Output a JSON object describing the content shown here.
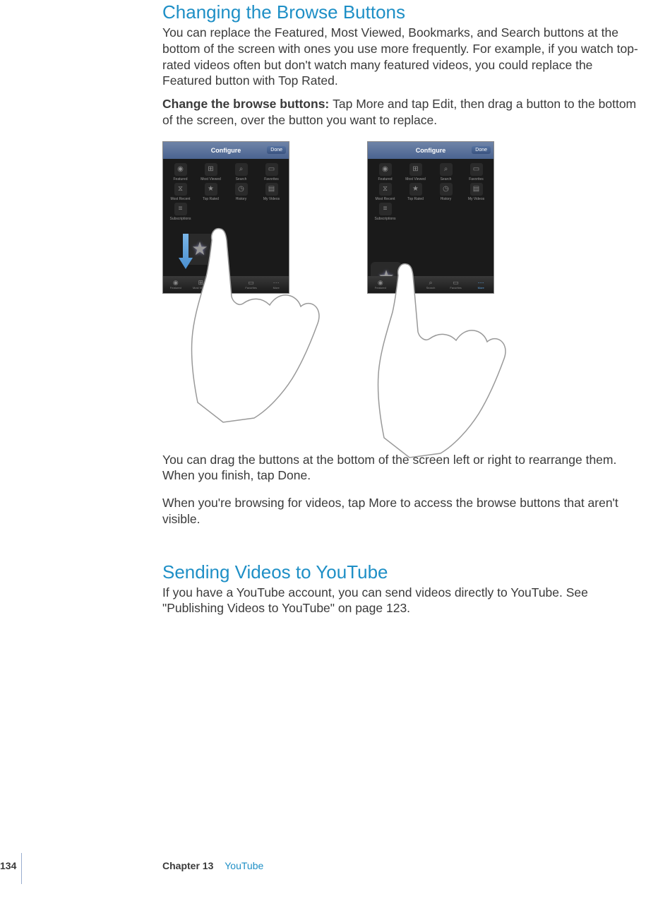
{
  "section1": {
    "heading": "Changing the Browse Buttons",
    "intro": "You can replace the Featured, Most Viewed, Bookmarks, and Search buttons at the bottom of the screen with ones you use more frequently. For example, if you watch top-rated videos often but don't watch many featured videos, you could replace the Featured button with Top Rated.",
    "instruction_label": "Change the browse buttons:  ",
    "instruction_text": "Tap More and tap Edit, then drag a button to the bottom of the screen, over the button you want to replace.",
    "after_figure_1": "You can drag the buttons at the bottom of the screen left or right to rearrange them. When you finish, tap Done.",
    "after_figure_2": "When you're browsing for videos, tap More to access the browse buttons that aren't visible."
  },
  "section2": {
    "heading": "Sending Videos to YouTube",
    "text": "If you have a YouTube account, you can send videos directly to YouTube. See \"Publishing Videos to YouTube\" on page 123."
  },
  "phone_ui": {
    "title": "Configure",
    "done": "Done",
    "icons": {
      "row1": [
        "Featured",
        "Most Viewed",
        "Search",
        "Favorites"
      ],
      "row2": [
        "Most Recent",
        "Top Rated",
        "History",
        "My Videos"
      ],
      "row3": [
        "Subscriptions",
        "",
        "",
        ""
      ]
    },
    "tabs": [
      "Featured",
      "Most Viewed",
      "Search",
      "Favorites",
      "More"
    ]
  },
  "footer": {
    "page": "134",
    "chapter": "Chapter 13",
    "title": "YouTube"
  }
}
